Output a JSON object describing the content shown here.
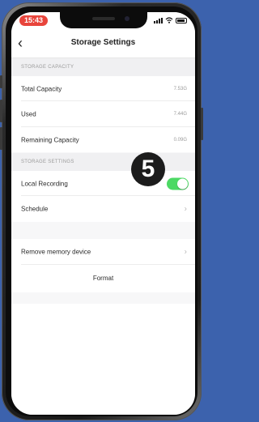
{
  "status_bar": {
    "time": "15:43"
  },
  "nav": {
    "back_icon": "chevron-left-icon",
    "title": "Storage Settings"
  },
  "storage_capacity": {
    "header": "STORAGE CAPACITY",
    "rows": [
      {
        "label": "Total Capacity",
        "value": "7.53G"
      },
      {
        "label": "Used",
        "value": "7.44G"
      },
      {
        "label": "Remaining Capacity",
        "value": "0.09G"
      }
    ]
  },
  "storage_settings": {
    "header": "STORAGE SETTINGS",
    "local_recording": {
      "label": "Local Recording",
      "enabled": true
    },
    "schedule": {
      "label": "Schedule"
    }
  },
  "remove_device": {
    "label": "Remove memory device"
  },
  "format": {
    "label": "Format"
  },
  "annotation": {
    "step": "5"
  },
  "colors": {
    "toggle_on": "#4cd964",
    "time_pill": "#e8453c",
    "background": "#3c62ad"
  }
}
